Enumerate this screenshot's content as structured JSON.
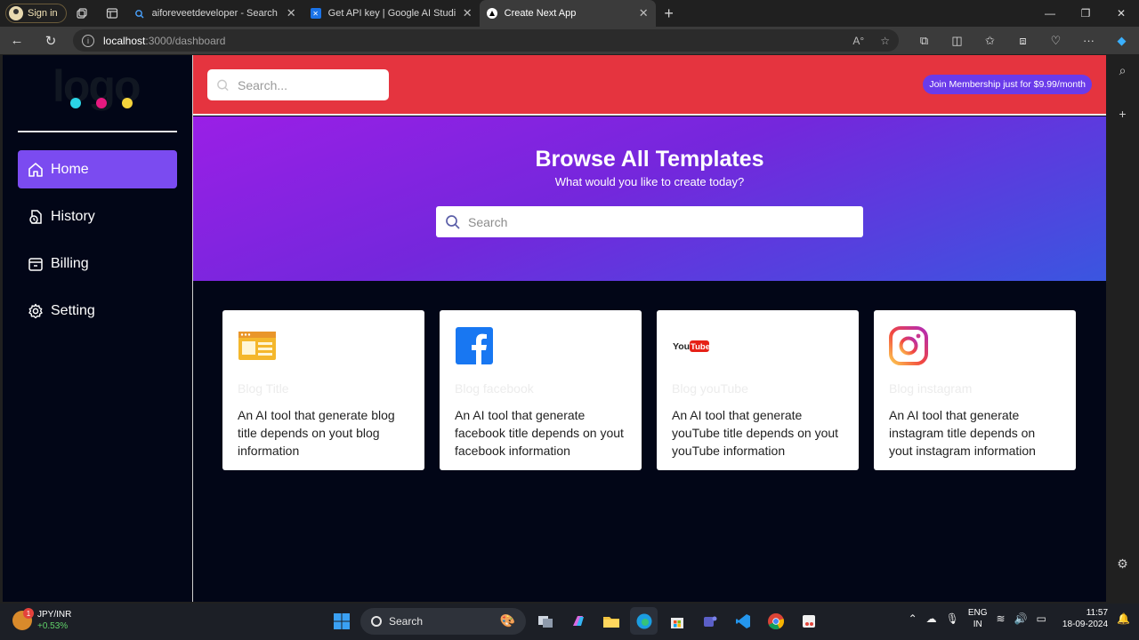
{
  "browser": {
    "profile_label": "Sign in",
    "tabs": [
      {
        "title": "aiforeveetdeveloper - Search",
        "active": false
      },
      {
        "title": "Get API key | Google AI Studio",
        "active": false
      },
      {
        "title": "Create Next App",
        "active": true
      }
    ],
    "url_host": "localhost",
    "url_rest": ":3000/dashboard"
  },
  "sidebar": {
    "logo_text": "logo",
    "logo_dot_colors": [
      "#2bd4e6",
      "#e6197f",
      "#f5d33b"
    ],
    "items": [
      {
        "label": "Home",
        "icon": "home-icon",
        "active": true
      },
      {
        "label": "History",
        "icon": "history-icon",
        "active": false
      },
      {
        "label": "Billing",
        "icon": "billing-icon",
        "active": false
      },
      {
        "label": "Setting",
        "icon": "gear-icon",
        "active": false
      }
    ]
  },
  "topbar": {
    "search_placeholder": "Search...",
    "membership_label": "Join Membership just for $9.99/month"
  },
  "hero": {
    "title": "Browse All Templates",
    "subtitle": "What would you like to create today?",
    "search_placeholder": "Search"
  },
  "cards": [
    {
      "name": "Blog Title",
      "icon": "blog-icon",
      "description": "An AI tool that generate blog title depends on yout blog information"
    },
    {
      "name": "Blog facebook",
      "icon": "facebook-icon",
      "description": "An AI tool that generate facebook title depends on yout facebook information"
    },
    {
      "name": "Blog youTube",
      "icon": "youtube-icon",
      "description": "An AI tool that generate youTube title depends on yout youTube information"
    },
    {
      "name": "Blog instagram",
      "icon": "instagram-icon",
      "description": "An AI tool that generate instagram title depends on yout instagram information"
    }
  ],
  "taskbar": {
    "widget_badge": "1",
    "widget_title": "JPY/INR",
    "widget_change": "+0.53%",
    "search_label": "Search",
    "lang_top": "ENG",
    "lang_bottom": "IN",
    "time": "11:57",
    "date": "18-09-2024"
  },
  "colors": {
    "accent": "#7b4bf0",
    "topbar": "#e5343f",
    "membership": "#6a3bea",
    "app_background": "#020617"
  }
}
